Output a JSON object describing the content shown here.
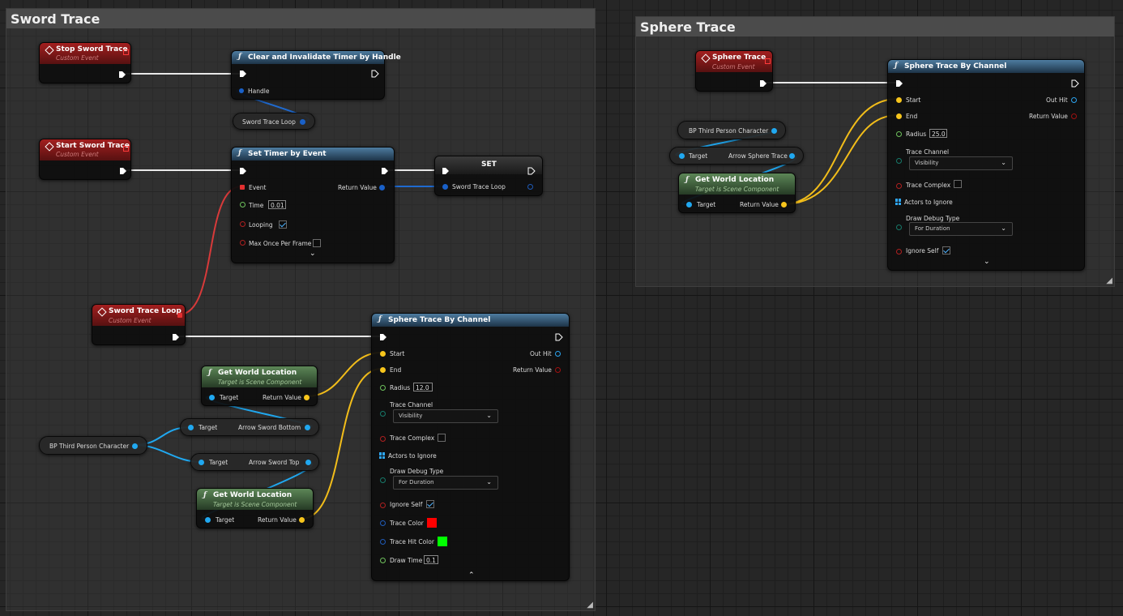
{
  "comments": {
    "sword": {
      "title": "Sword Trace"
    },
    "sphere": {
      "title": "Sphere Trace"
    }
  },
  "colors": {
    "exec_wire": "#e8e8e8",
    "object_pin": "#20a8f0",
    "vector_pin": "#f7c51c",
    "bool_pin": "#a01010",
    "float_pin": "#6ec15c",
    "event_header": "#a31f1f",
    "function_header": "#4d7ca0",
    "pure_header": "#5c8657",
    "trace_color": "#ff0000",
    "trace_hit_color": "#00ff00"
  },
  "nodes": {
    "stop_sword_trace": {
      "title": "Stop Sword Trace",
      "subtitle": "Custom Event"
    },
    "start_sword_trace": {
      "title": "Start Sword Trace",
      "subtitle": "Custom Event"
    },
    "sword_trace_loop_event": {
      "title": "Sword Trace Loop",
      "subtitle": "Custom Event"
    },
    "clear_timer": {
      "title": "Clear and Invalidate Timer by Handle",
      "handle_label": "Handle"
    },
    "sword_trace_loop_get": {
      "label": "Sword Trace Loop"
    },
    "set_timer": {
      "title": "Set Timer by Event",
      "event_label": "Event",
      "return_label": "Return Value",
      "time_label": "Time",
      "time_value": "0.01",
      "looping_label": "Looping",
      "looping_checked": true,
      "max_once_label": "Max Once Per Frame",
      "max_once_checked": false
    },
    "set_var": {
      "title": "SET",
      "var_label": "Sword Trace Loop"
    },
    "sword_sphere_trace": {
      "title": "Sphere Trace By Channel",
      "start_label": "Start",
      "end_label": "End",
      "out_hit_label": "Out Hit",
      "return_label": "Return Value",
      "radius_label": "Radius",
      "radius_value": "12.0",
      "trace_channel_label": "Trace Channel",
      "trace_channel_value": "Visibility",
      "trace_complex_label": "Trace Complex",
      "actors_to_ignore_label": "Actors to Ignore",
      "draw_debug_label": "Draw Debug Type",
      "draw_debug_value": "For Duration",
      "ignore_self_label": "Ignore Self",
      "trace_color_label": "Trace Color",
      "trace_hit_color_label": "Trace Hit Color",
      "draw_time_label": "Draw Time",
      "draw_time_value": "0.1"
    },
    "gwl_bottom": {
      "title": "Get World Location",
      "subtitle": "Target is Scene Component",
      "target_label": "Target",
      "return_label": "Return Value"
    },
    "gwl_top": {
      "title": "Get World Location",
      "subtitle": "Target is Scene Component",
      "target_label": "Target",
      "return_label": "Return Value"
    },
    "bp_third_person_left": {
      "label": "BP Third Person Character"
    },
    "arrow_bottom": {
      "target_label": "Target",
      "label": "Arrow Sword Bottom"
    },
    "arrow_top": {
      "target_label": "Target",
      "label": "Arrow Sword Top"
    },
    "sphere_trace_event": {
      "title": "Sphere Trace",
      "subtitle": "Custom Event"
    },
    "bp_third_person_right": {
      "label": "BP Third Person Character"
    },
    "arrow_sphere": {
      "target_label": "Target",
      "label": "Arrow Sphere Trace"
    },
    "gwl_sphere": {
      "title": "Get World Location",
      "subtitle": "Target is Scene Component",
      "target_label": "Target",
      "return_label": "Return Value"
    },
    "sphere_sphere_trace": {
      "title": "Sphere Trace By Channel",
      "start_label": "Start",
      "end_label": "End",
      "out_hit_label": "Out Hit",
      "return_label": "Return Value",
      "radius_label": "Radius",
      "radius_value": "25.0",
      "trace_channel_label": "Trace Channel",
      "trace_channel_value": "Visibility",
      "trace_complex_label": "Trace Complex",
      "actors_to_ignore_label": "Actors to Ignore",
      "draw_debug_label": "Draw Debug Type",
      "draw_debug_value": "For Duration",
      "ignore_self_label": "Ignore Self"
    }
  },
  "glyphs": {
    "func": "ƒ",
    "chev_down": "⌄",
    "chev_up": "⌃",
    "dd_arrow": "⌄",
    "resize": "◢"
  }
}
